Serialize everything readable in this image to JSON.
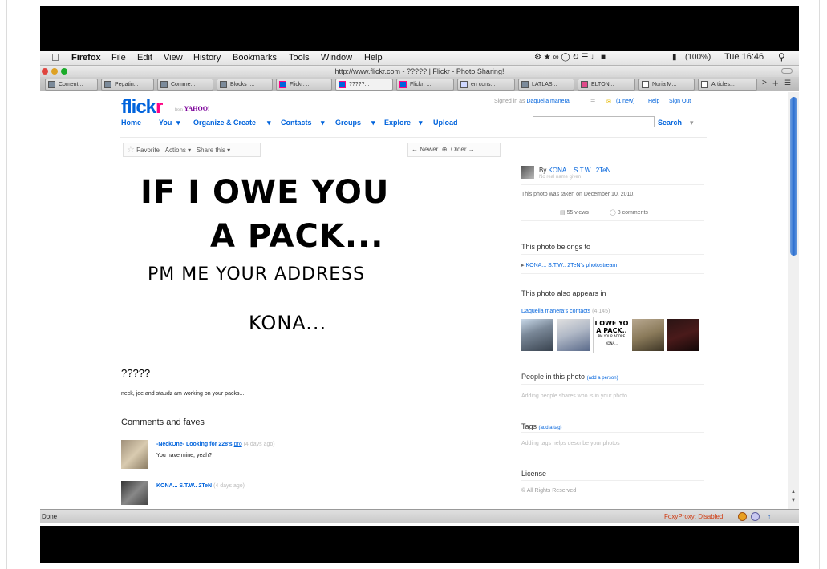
{
  "menubar": {
    "app": "Firefox",
    "items": [
      "File",
      "Edit",
      "View",
      "History",
      "Bookmarks",
      "Tools",
      "Window",
      "Help"
    ],
    "battery": "(100%)",
    "clock": "Tue 16:46"
  },
  "window": {
    "title": "http://www.flickr.com - ????? | Flickr - Photo Sharing!"
  },
  "tabs": [
    "Coment...",
    "Pegatin...",
    "Comme...",
    "Blocks |...",
    "Flickr: ...",
    "?????...",
    "Flickr: ...",
    "en cons...",
    "LATLAS...",
    "ELTON...",
    "Nuria M...",
    "Articles..."
  ],
  "flickr": {
    "logo_a": "flick",
    "logo_b": "r",
    "yahoo_from": "from",
    "yahoo": "YAHOO!",
    "nav": [
      "Home",
      "You",
      "Organize & Create",
      "Contacts",
      "Groups",
      "Explore",
      "Upload"
    ],
    "signed_in_prefix": "Signed in as",
    "signed_in_user": "Daquella manera",
    "new_mail": "(1 new)",
    "help": "Help",
    "signout": "Sign Out",
    "search_label": "Search"
  },
  "actions": {
    "favorite": "Favorite",
    "actions": "Actions",
    "share": "Share this",
    "newer": "← Newer",
    "older": "Older →"
  },
  "photo_text": {
    "line1": "IF I OWE YOU",
    "line2": "A PACK...",
    "line3": "PM ME YOUR ADDRESS",
    "line4": "KONA..."
  },
  "photo": {
    "title": "?????",
    "description": "neck, joe and staudz am working on your packs..."
  },
  "comments": {
    "heading": "Comments and faves",
    "items": [
      {
        "author": "-NeckOne- Looking for 228's",
        "badge": "pro",
        "time": "(4 days ago)",
        "text": "You have mine, yeah?"
      },
      {
        "author": "KONA... S.T.W.. 2TeN",
        "time": "(4 days ago)",
        "text": ""
      }
    ]
  },
  "sidebar": {
    "by": "By",
    "owner": "KONA... S.T.W.. 2TeN",
    "real_name": "No real name given",
    "taken": "This photo was taken on December 10, 2010.",
    "views": "55 views",
    "comments": "8 comments",
    "belongs_heading": "This photo belongs to",
    "photostream": "KONA... S.T.W.. 2TeN's photostream",
    "appears_heading": "This photo also appears in",
    "contacts_link": "Daquella manera's contacts",
    "contacts_count": "(4,145)",
    "people_heading": "People in this photo",
    "add_person": "(add a person)",
    "people_hint": "Adding people shares who is in your photo",
    "tags_heading": "Tags",
    "add_tag": "(add a tag)",
    "tags_hint": "Adding tags helps describe your photos",
    "license_heading": "License",
    "license": "All Rights Reserved",
    "thumb_mini_1": "I OWE YO",
    "thumb_mini_2": "A PACK..",
    "thumb_mini_3": "PM YOUR ADDRE",
    "thumb_mini_4": "KONA..."
  },
  "status": {
    "left": "Done",
    "foxyproxy": "FoxyProxy: Disabled"
  }
}
